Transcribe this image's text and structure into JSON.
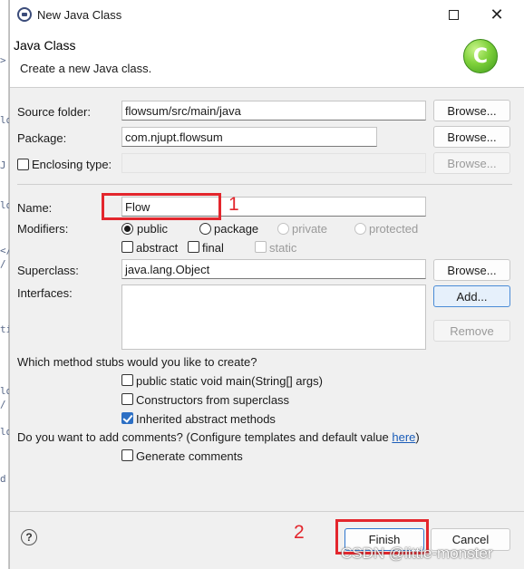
{
  "background_editor": {
    "glyphs": [
      ">",
      "ld",
      "J",
      "ld",
      "</",
      "/",
      "ti",
      "ld",
      "/",
      "ld",
      "d"
    ]
  },
  "window": {
    "title": "New Java Class",
    "close_glyph": "✕"
  },
  "header": {
    "title": "Java Class",
    "description": "Create a new Java class.",
    "icon_letter": "C",
    "icon_color": "#5cc12a"
  },
  "form": {
    "source_folder": {
      "label": "Source folder:",
      "value": "flowsum/src/main/java",
      "browse": "Browse..."
    },
    "package": {
      "label": "Package:",
      "value": "com.njupt.flowsum",
      "browse": "Browse..."
    },
    "enclosing_type": {
      "label": "Enclosing type:",
      "value": "",
      "browse": "Browse...",
      "checked": false
    },
    "name": {
      "label": "Name:",
      "value": "Flow"
    },
    "modifiers": {
      "label": "Modifiers:",
      "access": [
        {
          "label": "public",
          "selected": true,
          "enabled": true
        },
        {
          "label": "package",
          "selected": false,
          "enabled": true
        },
        {
          "label": "private",
          "selected": false,
          "enabled": false
        },
        {
          "label": "protected",
          "selected": false,
          "enabled": false
        }
      ],
      "other": [
        {
          "label": "abstract",
          "checked": false,
          "enabled": true
        },
        {
          "label": "final",
          "checked": false,
          "enabled": true
        },
        {
          "label": "static",
          "checked": false,
          "enabled": false
        }
      ]
    },
    "superclass": {
      "label": "Superclass:",
      "value": "java.lang.Object",
      "browse": "Browse..."
    },
    "interfaces": {
      "label": "Interfaces:",
      "add": "Add...",
      "remove": "Remove"
    },
    "stubs": {
      "question": "Which method stubs would you like to create?",
      "options": [
        {
          "label": "public static void main(String[] args)",
          "checked": false
        },
        {
          "label": "Constructors from superclass",
          "checked": false
        },
        {
          "label": "Inherited abstract methods",
          "checked": true
        }
      ]
    },
    "comments": {
      "question": "Do you want to add comments? (Configure templates and default value ",
      "link": "here",
      "close_paren": ")",
      "option": {
        "label": "Generate comments",
        "checked": false
      }
    }
  },
  "footer": {
    "help": "?",
    "finish": "Finish",
    "cancel": "Cancel"
  },
  "annotations": {
    "one": "1",
    "two": "2",
    "color": "#e3262d"
  },
  "watermark": "CSDN @little-monster"
}
